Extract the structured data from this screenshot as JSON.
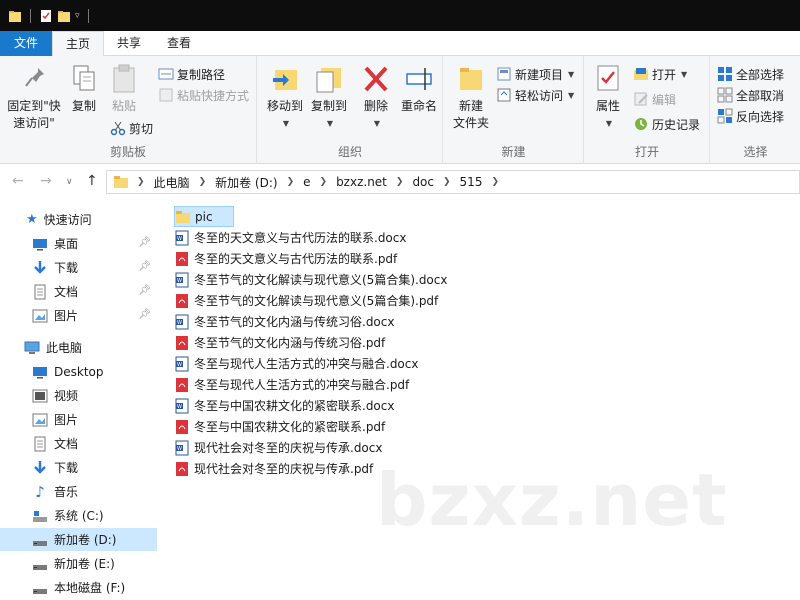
{
  "ribbon_tabs": [
    "文件",
    "主页",
    "共享",
    "查看"
  ],
  "clipboard": {
    "pin_label": "固定到\"快\n速访问\"",
    "pin_line1": "固定到\"快",
    "pin_line2": "速访问\"",
    "copy": "复制",
    "paste": "粘贴",
    "copy_path": "复制路径",
    "paste_shortcut": "粘贴快捷方式",
    "cut": "剪切",
    "label": "剪贴板"
  },
  "organize": {
    "move_to": "移动到",
    "copy_to": "复制到",
    "delete": "删除",
    "rename": "重命名",
    "label": "组织"
  },
  "new_group": {
    "new_folder_line1": "新建",
    "new_folder_line2": "文件夹",
    "new_item": "新建项目",
    "easy_access": "轻松访问",
    "label": "新建"
  },
  "open_group": {
    "properties": "属性",
    "open": "打开",
    "edit": "编辑",
    "history": "历史记录",
    "label": "打开"
  },
  "select_group": {
    "select_all": "全部选择",
    "select_none": "全部取消",
    "invert": "反向选择",
    "label": "选择"
  },
  "breadcrumb": [
    "此电脑",
    "新加卷 (D:)",
    "e",
    "bzxz.net",
    "doc",
    "515"
  ],
  "nav": {
    "quick_access": "快速访问",
    "quick_items": [
      {
        "label": "桌面",
        "icon": "desktop-icon"
      },
      {
        "label": "下载",
        "icon": "download-icon"
      },
      {
        "label": "文档",
        "icon": "documents-icon"
      },
      {
        "label": "图片",
        "icon": "pictures-icon"
      }
    ],
    "this_pc": "此电脑",
    "pc_items": [
      {
        "label": "Desktop",
        "icon": "desktop-icon"
      },
      {
        "label": "视频",
        "icon": "videos-icon"
      },
      {
        "label": "图片",
        "icon": "pictures-icon"
      },
      {
        "label": "文档",
        "icon": "documents-icon"
      },
      {
        "label": "下载",
        "icon": "download-icon"
      },
      {
        "label": "音乐",
        "icon": "music-icon"
      },
      {
        "label": "系统 (C:)",
        "icon": "drive-icon"
      },
      {
        "label": "新加卷 (D:)",
        "icon": "drive-icon"
      },
      {
        "label": "新加卷 (E:)",
        "icon": "drive-icon"
      },
      {
        "label": "本地磁盘 (F:)",
        "icon": "drive-icon"
      }
    ]
  },
  "files": [
    {
      "name": "pic",
      "type": "folder"
    },
    {
      "name": "冬至的天文意义与古代历法的联系.docx",
      "type": "docx"
    },
    {
      "name": "冬至的天文意义与古代历法的联系.pdf",
      "type": "pdf"
    },
    {
      "name": "冬至节气的文化解读与现代意义(5篇合集).docx",
      "type": "docx"
    },
    {
      "name": "冬至节气的文化解读与现代意义(5篇合集).pdf",
      "type": "pdf"
    },
    {
      "name": "冬至节气的文化内涵与传统习俗.docx",
      "type": "docx"
    },
    {
      "name": "冬至节气的文化内涵与传统习俗.pdf",
      "type": "pdf"
    },
    {
      "name": "冬至与现代人生活方式的冲突与融合.docx",
      "type": "docx"
    },
    {
      "name": "冬至与现代人生活方式的冲突与融合.pdf",
      "type": "pdf"
    },
    {
      "name": "冬至与中国农耕文化的紧密联系.docx",
      "type": "docx"
    },
    {
      "name": "冬至与中国农耕文化的紧密联系.pdf",
      "type": "pdf"
    },
    {
      "name": "现代社会对冬至的庆祝与传承.docx",
      "type": "docx"
    },
    {
      "name": "现代社会对冬至的庆祝与传承.pdf",
      "type": "pdf"
    }
  ],
  "watermark": "bzxz.net",
  "colors": {
    "accent": "#1979ca",
    "selection": "#cce8ff",
    "folder": "#f8d775",
    "pdf": "#d9353b",
    "word": "#2b579a"
  }
}
